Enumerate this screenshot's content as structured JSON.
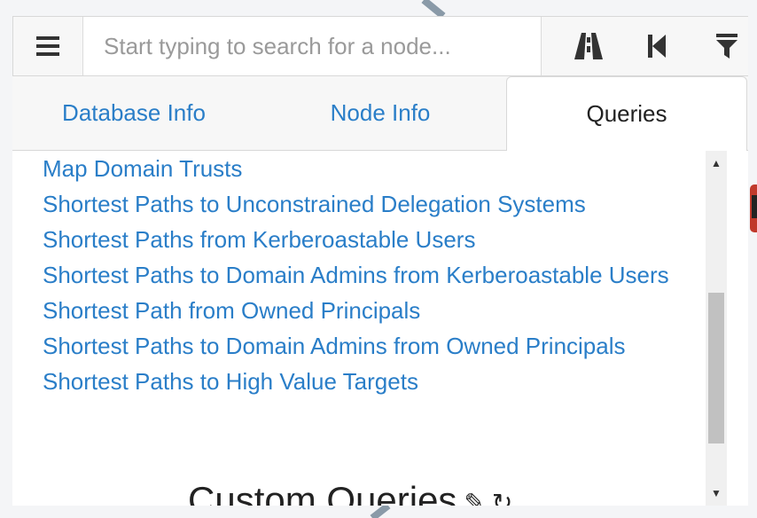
{
  "search": {
    "placeholder": "Start typing to search for a node..."
  },
  "toolbar": {
    "menu_icon": "hamburger-menu-icon",
    "pathfinding_icon": "road-icon",
    "back_icon": "step-backward-icon",
    "filter_icon": "filter-icon"
  },
  "tabs": [
    {
      "label": "Database Info",
      "active": false
    },
    {
      "label": "Node Info",
      "active": false
    },
    {
      "label": "Queries",
      "active": true
    }
  ],
  "queries": [
    "Map Domain Trusts",
    "Shortest Paths to Unconstrained Delegation Systems",
    "Shortest Paths from Kerberoastable Users",
    "Shortest Paths to Domain Admins from Kerberoastable Users",
    "Shortest Path from Owned Principals",
    "Shortest Paths to Domain Admins from Owned Principals",
    "Shortest Paths to High Value Targets"
  ],
  "custom_queries": {
    "title": "Custom Queries",
    "edit_icon": "pencil-icon",
    "refresh_icon": "refresh-icon"
  },
  "colors": {
    "link": "#2a7ec8",
    "text": "#222222",
    "panel_bg": "#ffffff",
    "toolbar_bg": "#f7f7f7"
  }
}
